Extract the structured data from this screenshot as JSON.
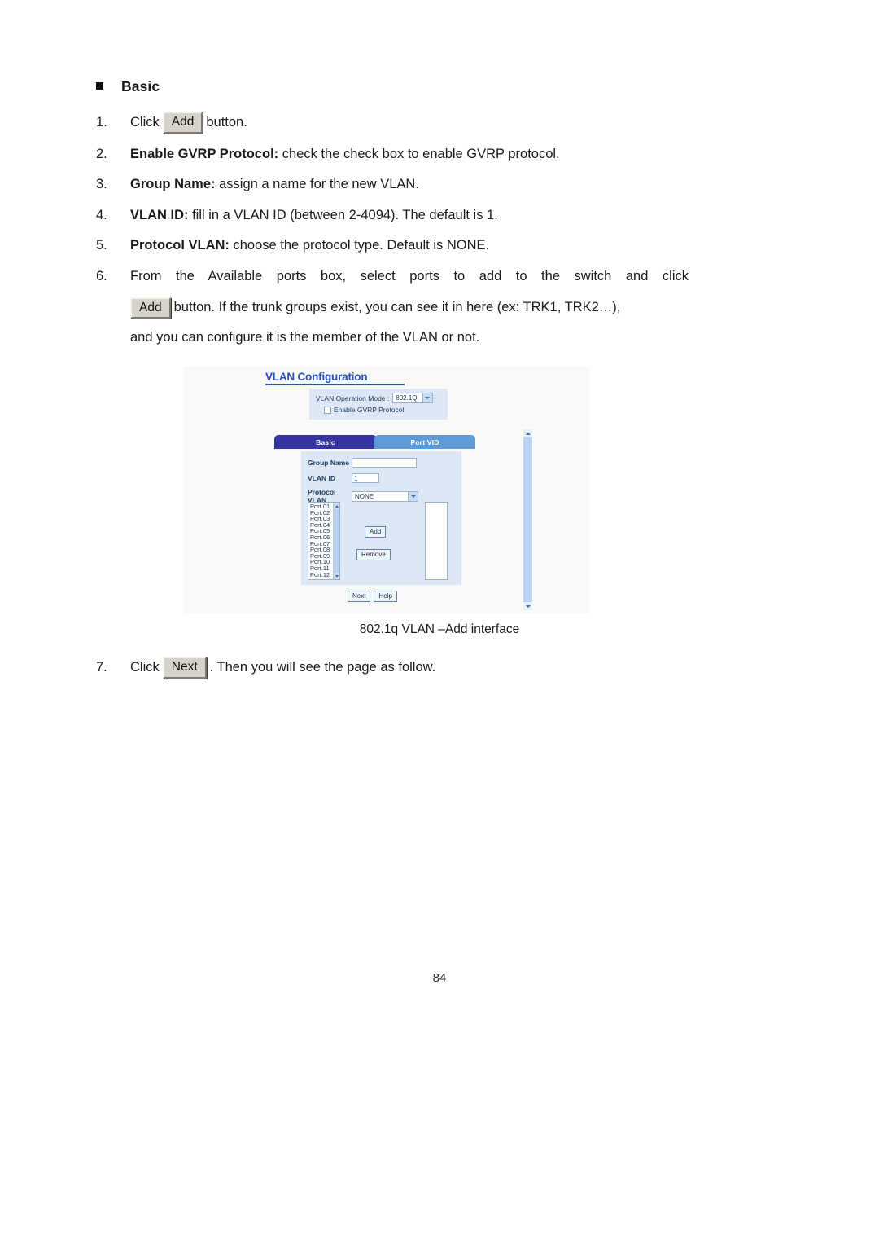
{
  "document": {
    "page_number": "84",
    "section_heading": "Basic"
  },
  "steps": [
    {
      "num": "1.",
      "pre": "Click",
      "button": "Add",
      "post": "button."
    },
    {
      "num": "2.",
      "bold": "Enable GVRP Protocol:",
      "rest": " check the check box to enable GVRP protocol."
    },
    {
      "num": "3.",
      "bold": "Group Name:",
      "rest": " assign a name for the new VLAN."
    },
    {
      "num": "4.",
      "bold": "VLAN ID:",
      "rest": " fill in a VLAN ID (between 2-4094). The default is 1."
    },
    {
      "num": "5.",
      "bold": "Protocol VLAN:",
      "rest": " choose the protocol type. Default is NONE."
    },
    {
      "num": "6.",
      "line1": "From the Available ports box, select ports to add to the switch and click",
      "button": "Add",
      "line2": "button. If the trunk groups exist, you can see it in here (ex: TRK1, TRK2…),",
      "line3": "and you can configure it is the member of the VLAN or not."
    },
    {
      "num": "7.",
      "pre": "Click",
      "button": "Next",
      "post": ". Then you will see the page as follow."
    }
  ],
  "figure": {
    "caption": "802.1q VLAN –Add interface",
    "title": "VLAN Configuration",
    "mode_panel": {
      "label": "VLAN Operation Mode :",
      "selected_mode": "802.1Q",
      "gvrp_label": "Enable GVRP Protocol",
      "gvrp_checked": false,
      "bg_color": "#dde7f5"
    },
    "tabs": [
      {
        "label": "Basic",
        "active": true,
        "color": "#3434a2"
      },
      {
        "label": "Port VID",
        "active": false,
        "color": "#5e9ad6"
      }
    ],
    "form": {
      "group_name_label": "Group Name",
      "group_name_value": "",
      "vlan_id_label": "VLAN ID",
      "vlan_id_value": "1",
      "protocol_vlan_label": "Protocol VLAN",
      "protocol_vlan_value": "NONE",
      "bg_color": "#dde8f6"
    },
    "available_ports": [
      "Port.01",
      "Port.02",
      "Port.03",
      "Port.04",
      "Port.05",
      "Port.06",
      "Port.07",
      "Port.08",
      "Port.09",
      "Port.10",
      "Port.11",
      "Port.12"
    ],
    "member_ports": [],
    "transfer_buttons": {
      "add": "Add",
      "remove": "Remove"
    },
    "bottom_buttons": {
      "next": "Next",
      "help": "Help"
    },
    "title_color": "#2a4fb8"
  }
}
